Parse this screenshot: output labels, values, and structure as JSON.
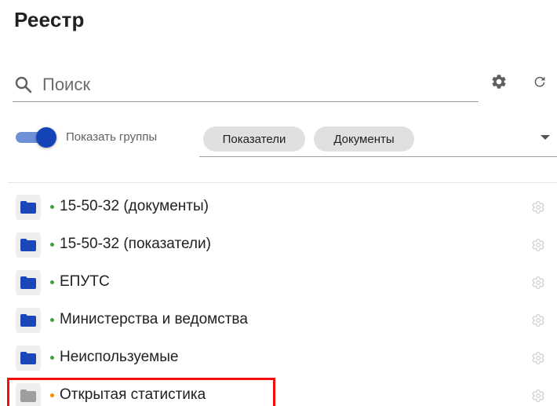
{
  "header": {
    "title": "Реестр"
  },
  "search": {
    "placeholder": "Поиск",
    "value": ""
  },
  "toolbar": {
    "settings_icon": "gear-icon",
    "refresh_icon": "refresh-icon"
  },
  "filters": {
    "show_groups_label": "Показать группы",
    "show_groups_on": true,
    "chips": [
      "Показатели",
      "Документы"
    ]
  },
  "colors": {
    "accent": "#1543b8",
    "folder_active": "#1a47b8",
    "folder_inactive": "#9e9e9e",
    "status_green": "#43a047",
    "status_orange": "#fb8c00",
    "highlight": "#f20c0c"
  },
  "registry": {
    "items": [
      {
        "label": "15-50-32 (документы)",
        "status": "green",
        "icon": "folder-icon"
      },
      {
        "label": "15-50-32 (показатели)",
        "status": "green",
        "icon": "folder-icon"
      },
      {
        "label": "ЕПУТС",
        "status": "green",
        "icon": "folder-icon"
      },
      {
        "label": "Министерства и ведомства",
        "status": "green",
        "icon": "folder-icon"
      },
      {
        "label": "Неиспользуемые",
        "status": "green",
        "icon": "folder-icon"
      },
      {
        "label": "Открытая статистика",
        "status": "orange",
        "icon": "folder-icon",
        "highlighted": true
      }
    ]
  }
}
